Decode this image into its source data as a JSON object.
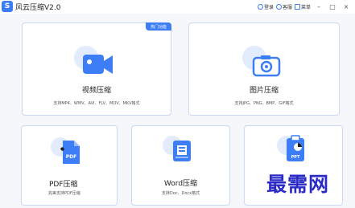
{
  "app": {
    "logo_glyph": "S",
    "title": "风云压缩V2.0"
  },
  "titlebar": {
    "login_label": "登录",
    "service_label": "客服",
    "menu_label": "菜单",
    "minimize_glyph": "–",
    "restore_glyph": "□",
    "close_glyph": "×"
  },
  "cards": {
    "video": {
      "badge": "热门功能",
      "title": "视频压缩",
      "desc": "支持MP4、WMV、AVI、FLV、MOV、MKV格式",
      "icon": "video-camera-icon"
    },
    "image": {
      "title": "图片压缩",
      "desc": "支持JPG、PNG、BMP、GIF格式",
      "icon": "camera-icon"
    },
    "pdf": {
      "title": "PDF压缩",
      "desc": "完美支持PDF压缩",
      "icon_text": "PDF",
      "icon": "pdf-file-icon"
    },
    "word": {
      "title": "Word压缩",
      "desc": "支持Doc、Docx格式",
      "icon": "word-file-icon"
    },
    "ppt": {
      "icon_text": "PPT",
      "icon": "ppt-clipboard-icon"
    }
  },
  "watermark": "最需网",
  "colors": {
    "accent": "#3d7df5",
    "halo": "#e3ecfc",
    "card_border": "#c9daf8",
    "watermark": "#2a2bc7"
  }
}
